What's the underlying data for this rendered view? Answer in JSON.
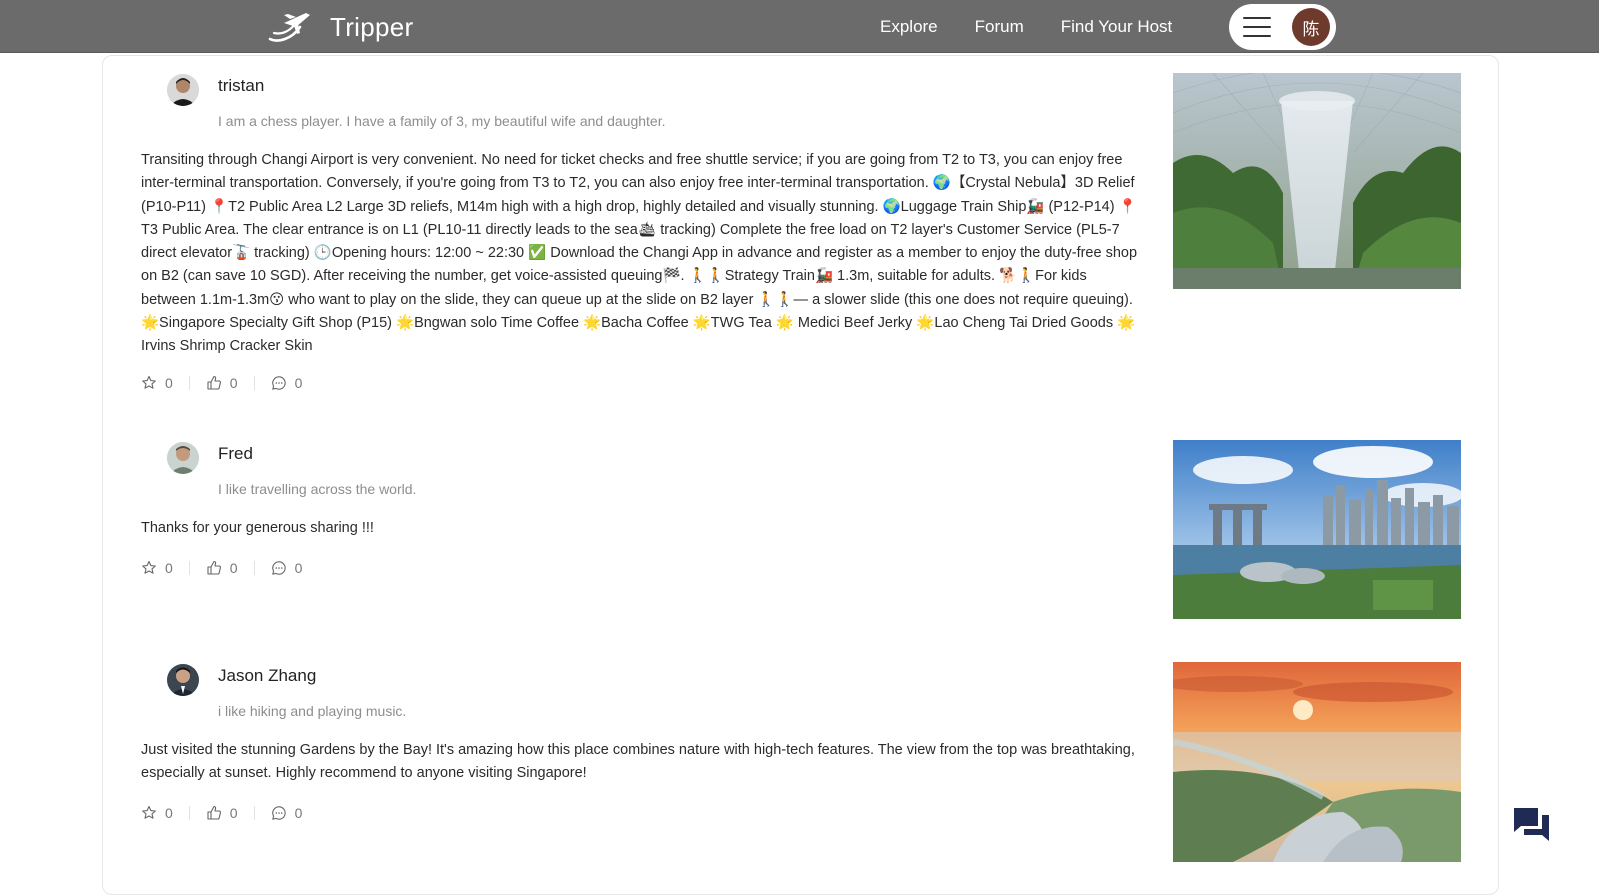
{
  "header": {
    "brand": "Tripper",
    "nav": [
      "Explore",
      "Forum",
      "Find Your Host"
    ],
    "user_initial": "陈"
  },
  "posts": [
    {
      "author": "tristan",
      "bio": "I am a chess player. I have a family of 3, my beautiful wife and daughter.",
      "body": "Transiting through Changi Airport is very convenient. No need for ticket checks and free shuttle service; if you are going from T2 to T3, you can enjoy free inter-terminal transportation. Conversely, if you're going from T3 to T2, you can also enjoy free inter-terminal transportation. 🌍【Crystal Nebula】3D Relief (P10-P11) 📍T2 Public Area L2 Large 3D reliefs, M14m high with a high drop, highly detailed and visually stunning. 🌍Luggage Train Ship🚂 (P12-P14) 📍T3 Public Area. The clear entrance is on L1 (PL10-11 directly leads to the sea🛳 tracking) Complete the free load on T2 layer's Customer Service (PL5-7 direct elevator🚡 tracking) 🕒Opening hours: 12:00 ~ 22:30 ✅ Download the Changi App in advance and register as a member to enjoy the duty-free shop on B2 (can save 10 SGD). After receiving the number, get voice-assisted queuing🏁. 🚶🚶Strategy Train🚂 1.3m, suitable for adults. 🐕🚶For kids between 1.1m-1.3m😗 who want to play on the slide, they can queue up at the slide on B2 layer 🚶🚶— a slower slide (this one does not require queuing). 🌟Singapore Specialty Gift Shop (P15) 🌟Bngwan solo Time Coffee 🌟Bacha Coffee 🌟TWG Tea 🌟 Medici Beef Jerky 🌟Lao Cheng Tai Dried Goods 🌟Irvins Shrimp Cracker Skin",
      "stars": "0",
      "likes": "0",
      "comments": "0"
    },
    {
      "author": "Fred",
      "bio": "I like travelling across the world.",
      "body": "Thanks for your generous sharing !!!",
      "stars": "0",
      "likes": "0",
      "comments": "0"
    },
    {
      "author": "Jason Zhang",
      "bio": "i like hiking and playing music.",
      "body": "Just visited the stunning Gardens by the Bay! It's amazing how this place combines nature with high-tech features. The view from the top was breathtaking, especially at sunset. Highly recommend to anyone visiting Singapore!",
      "stars": "0",
      "likes": "0",
      "comments": "0"
    }
  ],
  "icons": {
    "logo": "plane-swoosh-icon",
    "menu": "hamburger-icon",
    "star": "star-icon",
    "like": "thumbs-up-icon",
    "comment": "comment-bubble-icon",
    "chat": "chat-icon"
  },
  "colors": {
    "header_bg": "#6b6b6b",
    "avatar_bg": "#6d3a2c",
    "chat_icon": "#1f2a55"
  }
}
